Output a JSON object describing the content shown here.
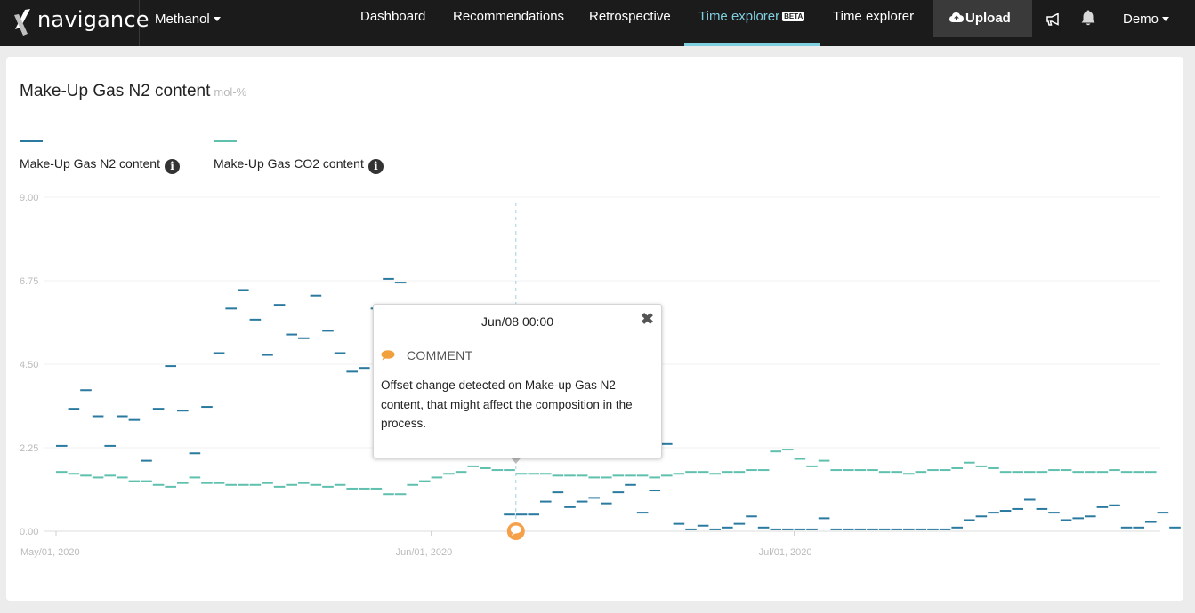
{
  "navbar": {
    "brand": "navigance",
    "plant": "Methanol",
    "links": [
      "Dashboard",
      "Recommendations",
      "Retrospective",
      "Time explorer",
      "Time explorer"
    ],
    "beta_badge": "BETA",
    "upload_label": "Upload",
    "user": "Demo"
  },
  "card": {
    "title": "Make-Up Gas N2 content",
    "unit": "mol-%"
  },
  "legend": [
    {
      "label": "Make-Up Gas N2 content",
      "color": "#2a7aa0"
    },
    {
      "label": "Make-Up Gas CO2 content",
      "color": "#5fc0ae"
    }
  ],
  "popup": {
    "date": "Jun/08 00:00",
    "type": "COMMENT",
    "text": "Offset change detected on Make-up Gas N2 content, that might affect the composition in the process."
  },
  "chart_data": {
    "type": "line",
    "x_unit": "day",
    "x_start": "2020-05-01",
    "xticks": [
      "May/01, 2020",
      "Jun/01, 2020",
      "Jul/01, 2020"
    ],
    "yticks": [
      "0.00",
      "2.25",
      "4.50",
      "6.75",
      "9.00"
    ],
    "ylim": [
      0,
      9
    ],
    "grid": true,
    "annotation_x": "2020-06-08",
    "series": [
      {
        "name": "Make-Up Gas N2 content",
        "color": "#2a7aa0",
        "style": "steps",
        "points": [
          [
            "2020-05-01",
            2.3
          ],
          [
            "2020-05-02",
            3.3
          ],
          [
            "2020-05-03",
            3.8
          ],
          [
            "2020-05-04",
            3.1
          ],
          [
            "2020-05-05",
            2.3
          ],
          [
            "2020-05-06",
            3.1
          ],
          [
            "2020-05-07",
            3.0
          ],
          [
            "2020-05-08",
            1.9
          ],
          [
            "2020-05-09",
            3.3
          ],
          [
            "2020-05-10",
            4.45
          ],
          [
            "2020-05-11",
            3.25
          ],
          [
            "2020-05-12",
            2.1
          ],
          [
            "2020-05-13",
            3.35
          ],
          [
            "2020-05-14",
            4.8
          ],
          [
            "2020-05-15",
            6.0
          ],
          [
            "2020-05-16",
            6.5
          ],
          [
            "2020-05-17",
            5.7
          ],
          [
            "2020-05-18",
            4.75
          ],
          [
            "2020-05-19",
            6.1
          ],
          [
            "2020-05-20",
            5.3
          ],
          [
            "2020-05-21",
            5.2
          ],
          [
            "2020-05-22",
            6.35
          ],
          [
            "2020-05-23",
            5.4
          ],
          [
            "2020-05-24",
            4.8
          ],
          [
            "2020-05-25",
            4.3
          ],
          [
            "2020-05-26",
            4.4
          ],
          [
            "2020-05-27",
            6.0
          ],
          [
            "2020-05-28",
            6.8
          ],
          [
            "2020-05-29",
            6.7
          ],
          [
            "2020-06-07",
            0.45
          ],
          [
            "2020-06-08",
            0.45
          ],
          [
            "2020-06-09",
            0.45
          ],
          [
            "2020-06-10",
            0.8
          ],
          [
            "2020-06-11",
            1.05
          ],
          [
            "2020-06-12",
            0.65
          ],
          [
            "2020-06-13",
            0.8
          ],
          [
            "2020-06-14",
            0.9
          ],
          [
            "2020-06-15",
            0.75
          ],
          [
            "2020-06-16",
            1.05
          ],
          [
            "2020-06-17",
            1.25
          ],
          [
            "2020-06-18",
            0.5
          ],
          [
            "2020-06-19",
            1.1
          ],
          [
            "2020-06-20",
            2.35
          ],
          [
            "2020-06-21",
            0.2
          ],
          [
            "2020-06-22",
            0.05
          ],
          [
            "2020-06-23",
            0.15
          ],
          [
            "2020-06-24",
            0.05
          ],
          [
            "2020-06-25",
            0.1
          ],
          [
            "2020-06-26",
            0.2
          ],
          [
            "2020-06-27",
            0.4
          ],
          [
            "2020-06-28",
            0.1
          ],
          [
            "2020-06-29",
            0.05
          ],
          [
            "2020-06-30",
            0.05
          ],
          [
            "2020-07-01",
            0.05
          ],
          [
            "2020-07-02",
            0.05
          ],
          [
            "2020-07-03",
            0.35
          ],
          [
            "2020-07-04",
            0.05
          ],
          [
            "2020-07-05",
            0.05
          ],
          [
            "2020-07-06",
            0.05
          ],
          [
            "2020-07-07",
            0.05
          ],
          [
            "2020-07-08",
            0.05
          ],
          [
            "2020-07-09",
            0.05
          ],
          [
            "2020-07-10",
            0.05
          ],
          [
            "2020-07-11",
            0.05
          ],
          [
            "2020-07-12",
            0.05
          ],
          [
            "2020-07-13",
            0.05
          ],
          [
            "2020-07-14",
            0.1
          ],
          [
            "2020-07-15",
            0.3
          ],
          [
            "2020-07-16",
            0.4
          ],
          [
            "2020-07-17",
            0.5
          ],
          [
            "2020-07-18",
            0.55
          ],
          [
            "2020-07-19",
            0.6
          ],
          [
            "2020-07-20",
            0.85
          ],
          [
            "2020-07-21",
            0.6
          ],
          [
            "2020-07-22",
            0.5
          ],
          [
            "2020-07-23",
            0.3
          ],
          [
            "2020-07-24",
            0.35
          ],
          [
            "2020-07-25",
            0.4
          ],
          [
            "2020-07-26",
            0.65
          ],
          [
            "2020-07-27",
            0.7
          ],
          [
            "2020-07-28",
            0.1
          ],
          [
            "2020-07-29",
            0.1
          ],
          [
            "2020-07-30",
            0.25
          ],
          [
            "2020-07-31",
            0.5
          ],
          [
            "2020-08-01",
            0.1
          ]
        ]
      },
      {
        "name": "Make-Up Gas CO2 content",
        "color": "#5fc0ae",
        "style": "steps",
        "points": [
          [
            "2020-05-01",
            1.6
          ],
          [
            "2020-05-02",
            1.55
          ],
          [
            "2020-05-03",
            1.5
          ],
          [
            "2020-05-04",
            1.45
          ],
          [
            "2020-05-05",
            1.5
          ],
          [
            "2020-05-06",
            1.45
          ],
          [
            "2020-05-07",
            1.35
          ],
          [
            "2020-05-08",
            1.35
          ],
          [
            "2020-05-09",
            1.25
          ],
          [
            "2020-05-10",
            1.2
          ],
          [
            "2020-05-11",
            1.3
          ],
          [
            "2020-05-12",
            1.45
          ],
          [
            "2020-05-13",
            1.3
          ],
          [
            "2020-05-14",
            1.3
          ],
          [
            "2020-05-15",
            1.25
          ],
          [
            "2020-05-16",
            1.25
          ],
          [
            "2020-05-17",
            1.25
          ],
          [
            "2020-05-18",
            1.3
          ],
          [
            "2020-05-19",
            1.2
          ],
          [
            "2020-05-20",
            1.25
          ],
          [
            "2020-05-21",
            1.3
          ],
          [
            "2020-05-22",
            1.25
          ],
          [
            "2020-05-23",
            1.2
          ],
          [
            "2020-05-24",
            1.25
          ],
          [
            "2020-05-25",
            1.15
          ],
          [
            "2020-05-26",
            1.15
          ],
          [
            "2020-05-27",
            1.15
          ],
          [
            "2020-05-28",
            1.0
          ],
          [
            "2020-05-29",
            1.0
          ],
          [
            "2020-05-30",
            1.25
          ],
          [
            "2020-05-31",
            1.35
          ],
          [
            "2020-06-01",
            1.45
          ],
          [
            "2020-06-02",
            1.55
          ],
          [
            "2020-06-03",
            1.6
          ],
          [
            "2020-06-04",
            1.75
          ],
          [
            "2020-06-05",
            1.7
          ],
          [
            "2020-06-06",
            1.65
          ],
          [
            "2020-06-07",
            1.65
          ],
          [
            "2020-06-08",
            1.55
          ],
          [
            "2020-06-09",
            1.55
          ],
          [
            "2020-06-10",
            1.55
          ],
          [
            "2020-06-11",
            1.5
          ],
          [
            "2020-06-12",
            1.5
          ],
          [
            "2020-06-13",
            1.5
          ],
          [
            "2020-06-14",
            1.45
          ],
          [
            "2020-06-15",
            1.45
          ],
          [
            "2020-06-16",
            1.5
          ],
          [
            "2020-06-17",
            1.5
          ],
          [
            "2020-06-18",
            1.5
          ],
          [
            "2020-06-19",
            1.45
          ],
          [
            "2020-06-20",
            1.5
          ],
          [
            "2020-06-21",
            1.55
          ],
          [
            "2020-06-22",
            1.6
          ],
          [
            "2020-06-23",
            1.6
          ],
          [
            "2020-06-24",
            1.55
          ],
          [
            "2020-06-25",
            1.6
          ],
          [
            "2020-06-26",
            1.6
          ],
          [
            "2020-06-27",
            1.65
          ],
          [
            "2020-06-28",
            1.65
          ],
          [
            "2020-06-29",
            2.15
          ],
          [
            "2020-06-30",
            2.2
          ],
          [
            "2020-07-01",
            1.95
          ],
          [
            "2020-07-02",
            1.75
          ],
          [
            "2020-07-03",
            1.9
          ],
          [
            "2020-07-04",
            1.65
          ],
          [
            "2020-07-05",
            1.65
          ],
          [
            "2020-07-06",
            1.65
          ],
          [
            "2020-07-07",
            1.65
          ],
          [
            "2020-07-08",
            1.6
          ],
          [
            "2020-07-09",
            1.6
          ],
          [
            "2020-07-10",
            1.55
          ],
          [
            "2020-07-11",
            1.6
          ],
          [
            "2020-07-12",
            1.65
          ],
          [
            "2020-07-13",
            1.65
          ],
          [
            "2020-07-14",
            1.7
          ],
          [
            "2020-07-15",
            1.85
          ],
          [
            "2020-07-16",
            1.75
          ],
          [
            "2020-07-17",
            1.7
          ],
          [
            "2020-07-18",
            1.6
          ],
          [
            "2020-07-19",
            1.6
          ],
          [
            "2020-07-20",
            1.6
          ],
          [
            "2020-07-21",
            1.6
          ],
          [
            "2020-07-22",
            1.65
          ],
          [
            "2020-07-23",
            1.65
          ],
          [
            "2020-07-24",
            1.6
          ],
          [
            "2020-07-25",
            1.6
          ],
          [
            "2020-07-26",
            1.6
          ],
          [
            "2020-07-27",
            1.65
          ],
          [
            "2020-07-28",
            1.6
          ],
          [
            "2020-07-29",
            1.6
          ],
          [
            "2020-07-30",
            1.6
          ]
        ]
      }
    ]
  }
}
